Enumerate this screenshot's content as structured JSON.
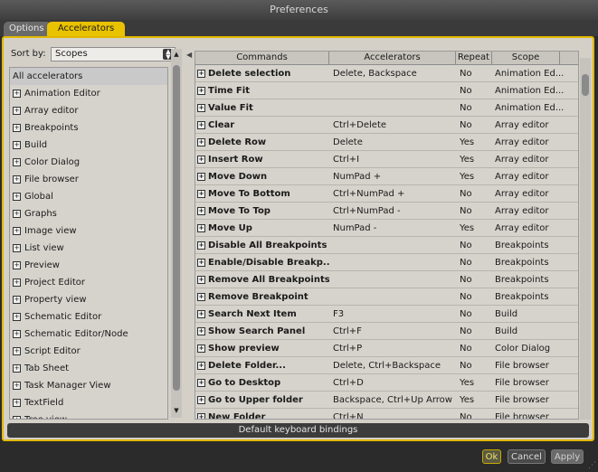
{
  "window": {
    "title": "Preferences"
  },
  "tabs": [
    {
      "label": "Options"
    },
    {
      "label": "Accelerators"
    }
  ],
  "sort": {
    "label": "Sort by:",
    "value": "Scopes"
  },
  "scopes": [
    "All accelerators",
    "Animation Editor",
    "Array editor",
    "Breakpoints",
    "Build",
    "Color Dialog",
    "File browser",
    "Global",
    "Graphs",
    "Image view",
    "List view",
    "Preview",
    "Project Editor",
    "Property view",
    "Schematic Editor",
    "Schematic Editor/Node",
    "Script Editor",
    "Tab Sheet",
    "Task Manager View",
    "TextField",
    "Tree view"
  ],
  "table": {
    "headers": [
      "Commands",
      "Accelerators",
      "Repeat",
      "Scope"
    ],
    "rows": [
      {
        "command": "Delete selection",
        "accel": "Delete, Backspace",
        "repeat": "No",
        "scope": "Animation Ed..."
      },
      {
        "command": "Time Fit",
        "accel": "",
        "repeat": "No",
        "scope": "Animation Ed..."
      },
      {
        "command": "Value Fit",
        "accel": "",
        "repeat": "No",
        "scope": "Animation Ed..."
      },
      {
        "command": "Clear",
        "accel": "Ctrl+Delete",
        "repeat": "No",
        "scope": "Array editor"
      },
      {
        "command": "Delete Row",
        "accel": "Delete",
        "repeat": "Yes",
        "scope": "Array editor"
      },
      {
        "command": "Insert Row",
        "accel": "Ctrl+I",
        "repeat": "Yes",
        "scope": "Array editor"
      },
      {
        "command": "Move Down",
        "accel": "NumPad +",
        "repeat": "Yes",
        "scope": "Array editor"
      },
      {
        "command": "Move To Bottom",
        "accel": "Ctrl+NumPad +",
        "repeat": "No",
        "scope": "Array editor"
      },
      {
        "command": "Move To Top",
        "accel": "Ctrl+NumPad -",
        "repeat": "No",
        "scope": "Array editor"
      },
      {
        "command": "Move Up",
        "accel": "NumPad -",
        "repeat": "Yes",
        "scope": "Array editor"
      },
      {
        "command": "Disable All Breakpoints",
        "accel": "",
        "repeat": "No",
        "scope": "Breakpoints"
      },
      {
        "command": "Enable/Disable  Breakp...",
        "accel": "",
        "repeat": "No",
        "scope": "Breakpoints"
      },
      {
        "command": "Remove All Breakpoints",
        "accel": "",
        "repeat": "No",
        "scope": "Breakpoints"
      },
      {
        "command": "Remove Breakpoint",
        "accel": "",
        "repeat": "No",
        "scope": "Breakpoints"
      },
      {
        "command": "Search Next Item",
        "accel": "F3",
        "repeat": "No",
        "scope": "Build"
      },
      {
        "command": "Show Search Panel",
        "accel": "Ctrl+F",
        "repeat": "No",
        "scope": "Build"
      },
      {
        "command": "Show preview",
        "accel": "Ctrl+P",
        "repeat": "No",
        "scope": "Color Dialog"
      },
      {
        "command": "Delete Folder...",
        "accel": "Delete, Ctrl+Backspace",
        "repeat": "No",
        "scope": "File browser"
      },
      {
        "command": "Go to Desktop",
        "accel": "Ctrl+D",
        "repeat": "Yes",
        "scope": "File browser"
      },
      {
        "command": "Go to Upper folder",
        "accel": "Backspace, Ctrl+Up Arrow",
        "repeat": "Yes",
        "scope": "File browser"
      },
      {
        "command": "New Folder",
        "accel": "Ctrl+N",
        "repeat": "No",
        "scope": "File browser"
      }
    ]
  },
  "default_button": "Default keyboard bindings",
  "buttons": {
    "ok": "Ok",
    "cancel": "Cancel",
    "apply": "Apply"
  }
}
